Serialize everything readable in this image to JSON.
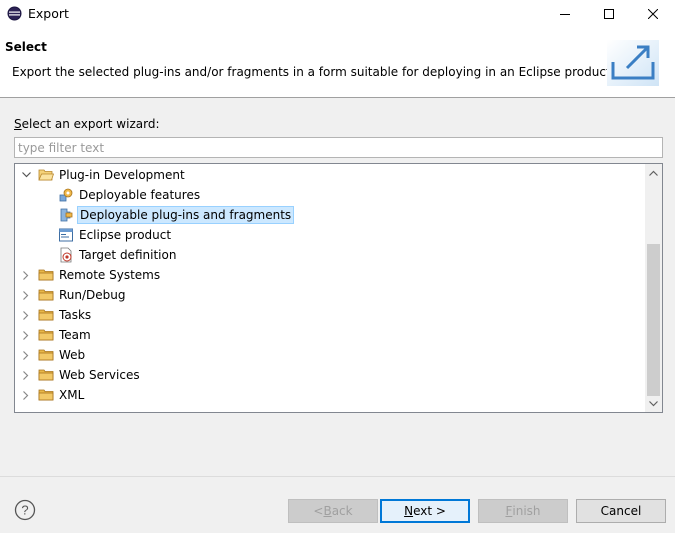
{
  "window": {
    "title": "Export",
    "minimize": "—",
    "maximize": "☐",
    "close": "✕"
  },
  "banner": {
    "title": "Select",
    "description": "Export the selected plug-ins and/or fragments in a form suitable for deploying in an Eclipse product."
  },
  "filter": {
    "label_mnemonic": "S",
    "label_rest": "elect an export wizard:",
    "placeholder": "type filter text"
  },
  "tree": {
    "items": [
      {
        "label": "Plug-in Development",
        "level": 0,
        "expanded": true,
        "icon": "folder-open-icon"
      },
      {
        "label": "Deployable features",
        "level": 1,
        "icon": "feature-icon"
      },
      {
        "label": "Deployable plug-ins and fragments",
        "level": 1,
        "icon": "plugin-icon",
        "selected": true
      },
      {
        "label": "Eclipse product",
        "level": 1,
        "icon": "product-icon"
      },
      {
        "label": "Target definition",
        "level": 1,
        "icon": "target-icon"
      },
      {
        "label": "Remote Systems",
        "level": 0,
        "expanded": false,
        "icon": "folder-icon"
      },
      {
        "label": "Run/Debug",
        "level": 0,
        "expanded": false,
        "icon": "folder-icon"
      },
      {
        "label": "Tasks",
        "level": 0,
        "expanded": false,
        "icon": "folder-icon"
      },
      {
        "label": "Team",
        "level": 0,
        "expanded": false,
        "icon": "folder-icon"
      },
      {
        "label": "Web",
        "level": 0,
        "expanded": false,
        "icon": "folder-icon"
      },
      {
        "label": "Web Services",
        "level": 0,
        "expanded": false,
        "icon": "folder-icon"
      },
      {
        "label": "XML",
        "level": 0,
        "expanded": false,
        "icon": "folder-icon"
      }
    ]
  },
  "buttons": {
    "back_mnemonic": "B",
    "back_prefix": "< ",
    "back_rest": "ack",
    "next_mnemonic": "N",
    "next_rest": "ext >",
    "finish_mnemonic": "F",
    "finish_rest": "inish",
    "cancel": "Cancel"
  },
  "colors": {
    "accent": "#0078d7",
    "selection_bg": "#cce8ff",
    "folder": "#e8b84a"
  }
}
